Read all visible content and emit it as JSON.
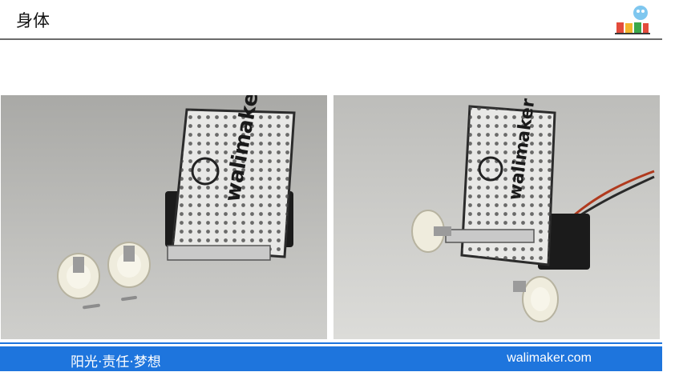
{
  "header": {
    "title": "身体"
  },
  "photos": {
    "left": {
      "board_text": "walimaker"
    },
    "right": {
      "board_text": "walimaker"
    }
  },
  "footer": {
    "slogan": "阳光·责任·梦想",
    "website": "walimaker.com"
  },
  "colors": {
    "footer_bg": "#1e75dd",
    "header_rule": "#6b6b6b",
    "photo_bg": "#b8b8b4"
  }
}
